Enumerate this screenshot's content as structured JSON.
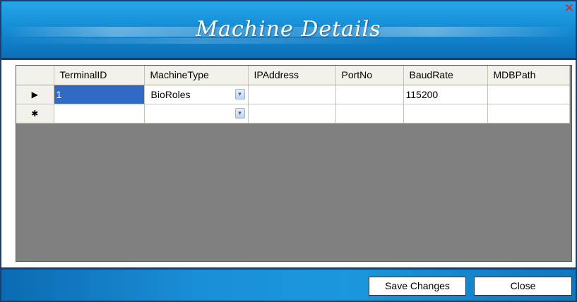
{
  "window": {
    "title": "Machine Details",
    "close_glyph": "✕"
  },
  "grid": {
    "columns": [
      "TerminalID",
      "MachineType",
      "IPAddress",
      "PortNo",
      "BaudRate",
      "MDBPath"
    ],
    "rows": [
      {
        "indicator": "▶",
        "TerminalID": "1",
        "MachineType": "BioRoles",
        "IPAddress": "",
        "PortNo": "",
        "BaudRate": "115200",
        "MDBPath": ""
      },
      {
        "indicator": "✱",
        "TerminalID": "",
        "MachineType": "",
        "IPAddress": "",
        "PortNo": "",
        "BaudRate": "",
        "MDBPath": ""
      }
    ],
    "dropdown_glyph": "▾"
  },
  "footer": {
    "save_label": "Save Changes",
    "close_label": "Close"
  },
  "colors": {
    "header": "#148dd6",
    "grid_background": "#808080",
    "selected_cell": "#3169c6"
  }
}
